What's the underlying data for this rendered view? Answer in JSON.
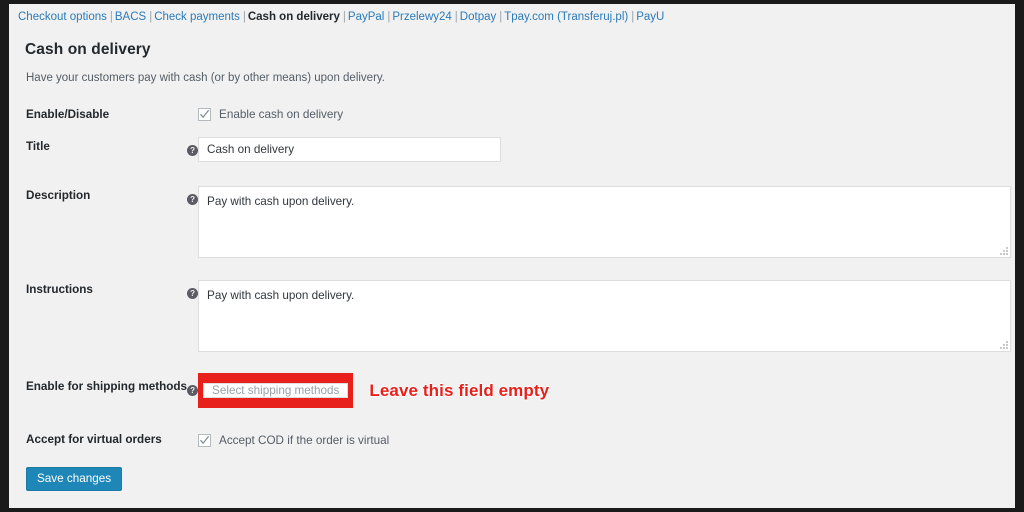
{
  "subnav": {
    "separator": "|",
    "items": [
      {
        "label": "Checkout options",
        "current": false
      },
      {
        "label": "BACS",
        "current": false
      },
      {
        "label": "Check payments",
        "current": false
      },
      {
        "label": "Cash on delivery",
        "current": true
      },
      {
        "label": "PayPal",
        "current": false
      },
      {
        "label": "Przelewy24",
        "current": false
      },
      {
        "label": "Dotpay",
        "current": false
      },
      {
        "label": "Tpay.com (Transferuj.pl)",
        "current": false
      },
      {
        "label": "PayU",
        "current": false
      }
    ]
  },
  "page": {
    "title": "Cash on delivery",
    "description": "Have your customers pay with cash (or by other means) upon delivery."
  },
  "fields": {
    "enable": {
      "label": "Enable/Disable",
      "checkbox_label": "Enable cash on delivery",
      "checked": true
    },
    "title": {
      "label": "Title",
      "value": "Cash on delivery",
      "help": "?"
    },
    "description": {
      "label": "Description",
      "value": "Pay with cash upon delivery.",
      "help": "?"
    },
    "instructions": {
      "label": "Instructions",
      "value": "Pay with cash upon delivery.",
      "help": "?"
    },
    "shipping_methods": {
      "label": "Enable for shipping methods",
      "placeholder": "Select shipping methods",
      "value": "",
      "help": "?"
    },
    "virtual_orders": {
      "label": "Accept for virtual orders",
      "checkbox_label": "Accept COD if the order is virtual",
      "checked": true
    }
  },
  "annotation": {
    "text": "Leave this field empty"
  },
  "actions": {
    "save_label": "Save changes"
  },
  "colors": {
    "link": "#2b7bb9",
    "annotation_red": "#e8201c",
    "primary_button": "#1e87b8",
    "panel_background": "#f1f1f1",
    "frame": "#1a1a1a"
  }
}
